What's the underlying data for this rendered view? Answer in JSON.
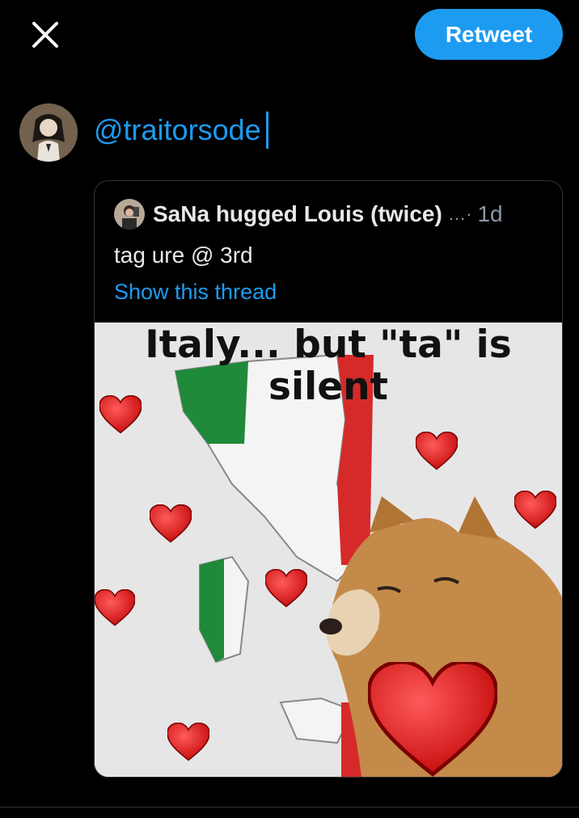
{
  "toolbar": {
    "close_icon": "close-icon",
    "retweet_label": "Retweet"
  },
  "compose": {
    "text": "@traitorsode"
  },
  "quote": {
    "author_name": "SaNa hugged Louis (twice)",
    "ellipsis": "...·",
    "time": "1d",
    "text": "tag ure @ 3rd",
    "show_thread": "Show this thread",
    "media": {
      "caption_line1": "Italy... but \"ta\" is",
      "caption_line2": "silent"
    }
  },
  "colors": {
    "accent": "#1d9bf0",
    "background": "#000000",
    "border": "#2f3336",
    "secondary_text": "#8b98a5"
  }
}
